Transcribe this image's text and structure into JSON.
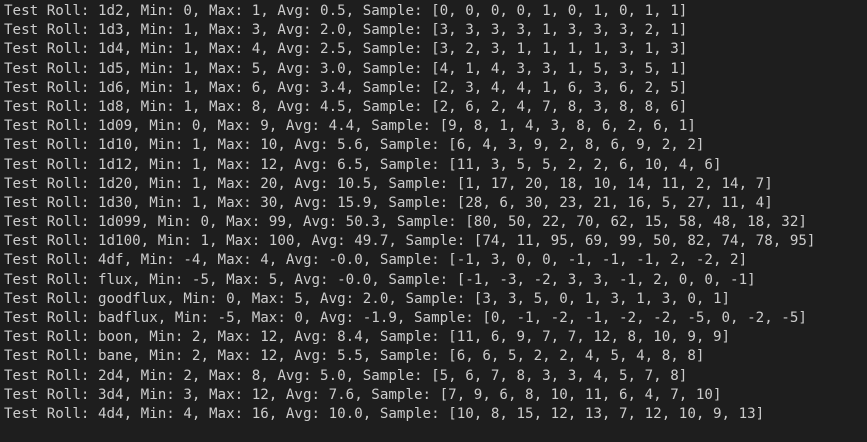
{
  "terminal": {
    "lines": [
      "Test Roll: 1d2, Min: 0, Max: 1, Avg: 0.5, Sample: [0, 0, 0, 0, 1, 0, 1, 0, 1, 1]",
      "Test Roll: 1d3, Min: 1, Max: 3, Avg: 2.0, Sample: [3, 3, 3, 3, 1, 3, 3, 3, 2, 1]",
      "Test Roll: 1d4, Min: 1, Max: 4, Avg: 2.5, Sample: [3, 2, 3, 1, 1, 1, 1, 3, 1, 3]",
      "Test Roll: 1d5, Min: 1, Max: 5, Avg: 3.0, Sample: [4, 1, 4, 3, 3, 1, 5, 3, 5, 1]",
      "Test Roll: 1d6, Min: 1, Max: 6, Avg: 3.4, Sample: [2, 3, 4, 4, 1, 6, 3, 6, 2, 5]",
      "Test Roll: 1d8, Min: 1, Max: 8, Avg: 4.5, Sample: [2, 6, 2, 4, 7, 8, 3, 8, 8, 6]",
      "Test Roll: 1d09, Min: 0, Max: 9, Avg: 4.4, Sample: [9, 8, 1, 4, 3, 8, 6, 2, 6, 1]",
      "Test Roll: 1d10, Min: 1, Max: 10, Avg: 5.6, Sample: [6, 4, 3, 9, 2, 8, 6, 9, 2, 2]",
      "Test Roll: 1d12, Min: 1, Max: 12, Avg: 6.5, Sample: [11, 3, 5, 5, 2, 2, 6, 10, 4, 6]",
      "Test Roll: 1d20, Min: 1, Max: 20, Avg: 10.5, Sample: [1, 17, 20, 18, 10, 14, 11, 2, 14, 7]",
      "Test Roll: 1d30, Min: 1, Max: 30, Avg: 15.9, Sample: [28, 6, 30, 23, 21, 16, 5, 27, 11, 4]",
      "Test Roll: 1d099, Min: 0, Max: 99, Avg: 50.3, Sample: [80, 50, 22, 70, 62, 15, 58, 48, 18, 32]",
      "Test Roll: 1d100, Min: 1, Max: 100, Avg: 49.7, Sample: [74, 11, 95, 69, 99, 50, 82, 74, 78, 95]",
      "Test Roll: 4df, Min: -4, Max: 4, Avg: -0.0, Sample: [-1, 3, 0, 0, -1, -1, -1, 2, -2, 2]",
      "Test Roll: flux, Min: -5, Max: 5, Avg: -0.0, Sample: [-1, -3, -2, 3, 3, -1, 2, 0, 0, -1]",
      "Test Roll: goodflux, Min: 0, Max: 5, Avg: 2.0, Sample: [3, 3, 5, 0, 1, 3, 1, 3, 0, 1]",
      "Test Roll: badflux, Min: -5, Max: 0, Avg: -1.9, Sample: [0, -1, -2, -1, -2, -2, -5, 0, -2, -5]",
      "Test Roll: boon, Min: 2, Max: 12, Avg: 8.4, Sample: [11, 6, 9, 7, 7, 12, 8, 10, 9, 9]",
      "Test Roll: bane, Min: 2, Max: 12, Avg: 5.5, Sample: [6, 6, 5, 2, 2, 4, 5, 4, 8, 8]",
      "Test Roll: 2d4, Min: 2, Max: 8, Avg: 5.0, Sample: [5, 6, 7, 8, 3, 3, 4, 5, 7, 8]",
      "Test Roll: 3d4, Min: 3, Max: 12, Avg: 7.6, Sample: [7, 9, 6, 8, 10, 11, 6, 4, 7, 10]",
      "Test Roll: 4d4, Min: 4, Max: 16, Avg: 10.0, Sample: [10, 8, 15, 12, 13, 7, 12, 10, 9, 13]"
    ]
  },
  "colors": {
    "background": "#1e1e1e",
    "text": "#cccccc"
  }
}
